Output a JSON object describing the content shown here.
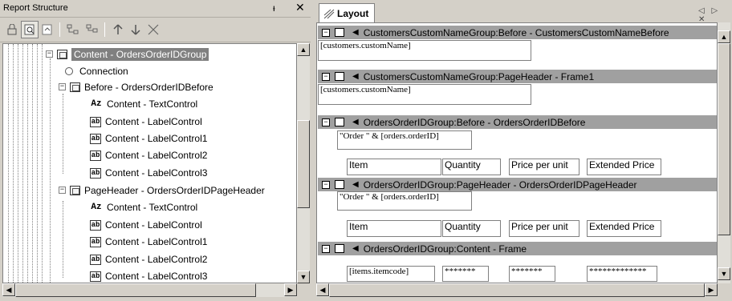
{
  "left_panel": {
    "title": "Report Structure",
    "pin_glyph": "ᵻ",
    "close_glyph": "✕",
    "toolbar_icons": [
      "lock-icon",
      "find-icon",
      "refresh-icon",
      "add-child-icon",
      "group-icon",
      "move-up-icon",
      "move-down-icon",
      "delete-icon"
    ],
    "tree": [
      {
        "label": "Content - OrdersOrderIDGroup",
        "icon": "frame",
        "selected": true
      },
      {
        "label": "Connection",
        "icon": "connection"
      },
      {
        "label": "Before - OrdersOrderIDBefore",
        "icon": "frame"
      },
      {
        "label": "Content - TextControl",
        "icon": "text"
      },
      {
        "label": "Content - LabelControl",
        "icon": "label"
      },
      {
        "label": "Content - LabelControl1",
        "icon": "label"
      },
      {
        "label": "Content - LabelControl2",
        "icon": "label"
      },
      {
        "label": "Content - LabelControl3",
        "icon": "label"
      },
      {
        "label": "PageHeader - OrdersOrderIDPageHeader",
        "icon": "frame"
      },
      {
        "label": "Content - TextControl",
        "icon": "text"
      },
      {
        "label": "Content - LabelControl",
        "icon": "label"
      },
      {
        "label": "Content - LabelControl1",
        "icon": "label"
      },
      {
        "label": "Content - LabelControl2",
        "icon": "label"
      },
      {
        "label": "Content - LabelControl3",
        "icon": "label"
      }
    ]
  },
  "right_panel": {
    "tab_label": "Layout",
    "tab_nav": "◁ ▷ ✕",
    "bands": [
      {
        "title": "CustomersCustomNameGroup:Before - CustomersCustomNameBefore"
      },
      {
        "title": "CustomersCustomNameGroup:PageHeader - Frame1"
      },
      {
        "title": "OrdersOrderIDGroup:Before - OrdersOrderIDBefore"
      },
      {
        "title": "OrdersOrderIDGroup:PageHeader - OrdersOrderIDPageHeader"
      },
      {
        "title": "OrdersOrderIDGroup:Content - Frame"
      }
    ],
    "fields": {
      "cust_name_1": "[customers.customName]",
      "cust_name_2": "[customers.customName]",
      "order_expr_1": "\"Order \" & [orders.orderID]",
      "order_expr_2": "\"Order \" & [orders.orderID]",
      "itemcode": "[items.itemcode]",
      "mask_1": "*******",
      "mask_2": "*******",
      "mask_3": "*************"
    },
    "labels": {
      "item": "Item",
      "quantity": "Quantity",
      "price": "Price per unit",
      "extended": "Extended Price"
    }
  }
}
